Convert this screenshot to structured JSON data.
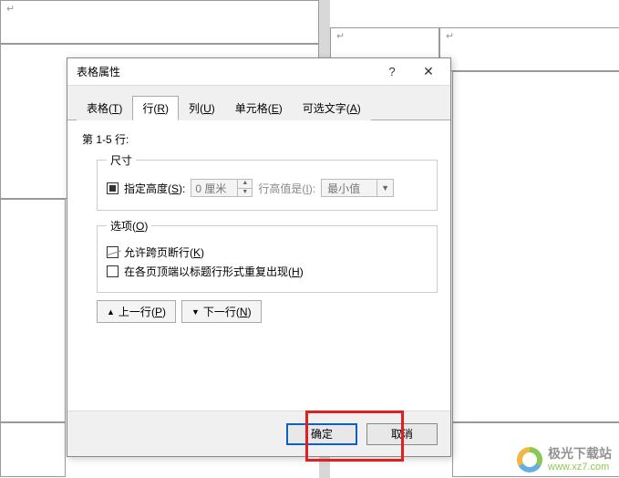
{
  "cell_mark": "↵",
  "dialog": {
    "title": "表格属性",
    "help_symbol": "?",
    "close_symbol": "✕",
    "tabs": {
      "table": {
        "label": "表格",
        "hotkey": "T"
      },
      "row": {
        "label": "行",
        "hotkey": "R"
      },
      "column": {
        "label": "列",
        "hotkey": "U"
      },
      "cell": {
        "label": "单元格",
        "hotkey": "E"
      },
      "alt_text": {
        "label": "可选文字",
        "hotkey": "A"
      }
    },
    "content": {
      "row_range_label": "第 1-5 行:",
      "size": {
        "legend": "尺寸",
        "specify_height_label": "指定高度",
        "specify_height_hotkey": "S",
        "height_value": "0 厘米",
        "row_height_is_label": "行高值是",
        "row_height_is_hotkey": "I",
        "row_height_mode": "最小值"
      },
      "options": {
        "legend": "选项",
        "allow_break_label": "允许跨页断行",
        "allow_break_hotkey": "K",
        "repeat_header_label": "在各页顶端以标题行形式重复出现",
        "repeat_header_hotkey": "H"
      },
      "prev_row": {
        "label": "上一行",
        "hotkey": "P",
        "arrow": "▲"
      },
      "next_row": {
        "label": "下一行",
        "hotkey": "N",
        "arrow": "▼"
      }
    },
    "footer": {
      "ok_label": "确定",
      "cancel_label": "取消"
    }
  },
  "watermark": {
    "name": "极光下载站",
    "url": "www.xz7.com"
  }
}
